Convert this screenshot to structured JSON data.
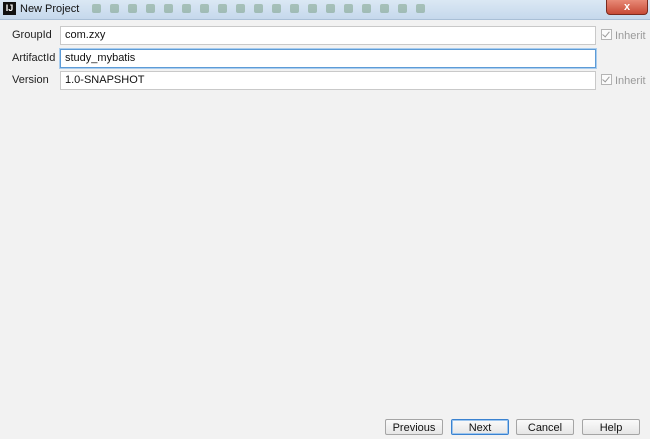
{
  "window": {
    "title": "New Project",
    "app_icon_glyph": "IJ",
    "close_glyph": "x"
  },
  "form": {
    "group_id": {
      "label": "GroupId",
      "value": "com.zxy",
      "inherit": {
        "label": "Inherit",
        "checked": true,
        "enabled": false
      }
    },
    "artifact_id": {
      "label": "ArtifactId",
      "value": "study_mybatis"
    },
    "version": {
      "label": "Version",
      "value": "1.0-SNAPSHOT",
      "inherit": {
        "label": "Inherit",
        "checked": true,
        "enabled": false
      }
    }
  },
  "buttons": {
    "previous": "Previous",
    "next": "Next",
    "cancel": "Cancel",
    "help": "Help"
  },
  "colors": {
    "background": "#f2f2f2",
    "titlebar": "#c5d8ec",
    "focus_border": "#5d9bd6",
    "close_button": "#c74a36"
  },
  "icons": [
    "intellij-app-icon",
    "close-icon",
    "checkbox-checked-icon"
  ]
}
